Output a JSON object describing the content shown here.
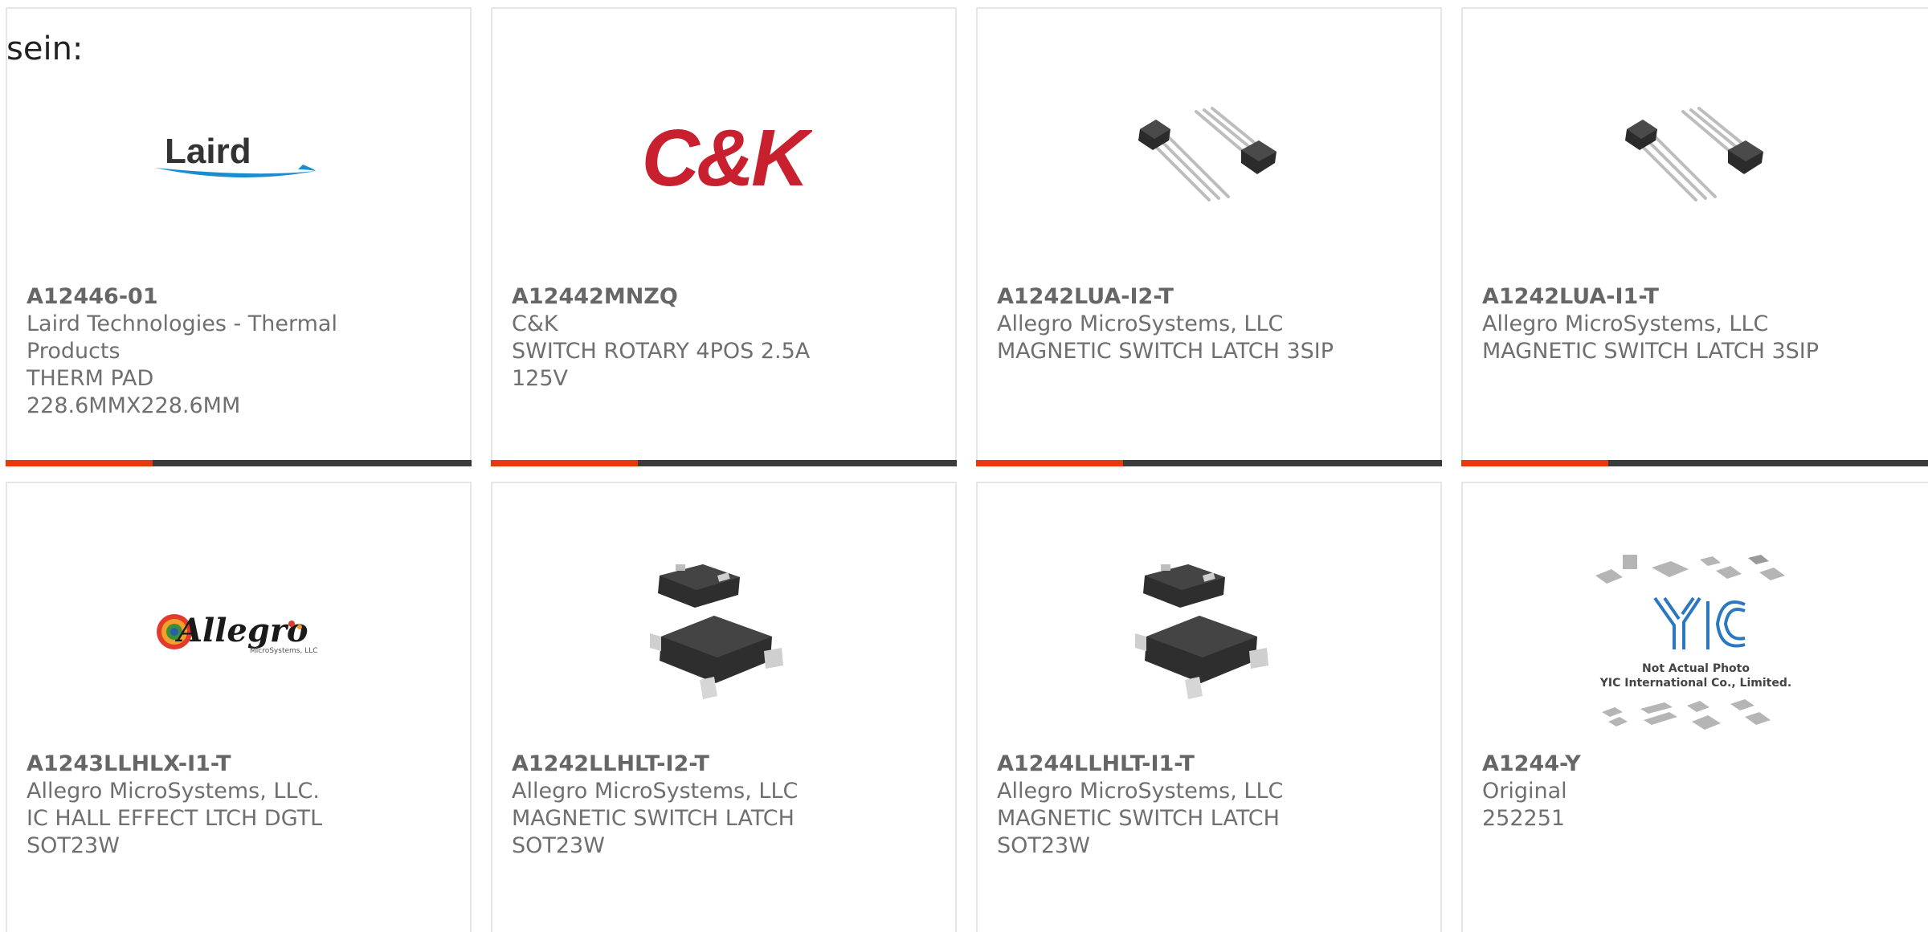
{
  "page": {
    "caption": "sein:"
  },
  "products": [
    {
      "part_number": "A12446-01",
      "manufacturer": "Laird Technologies - Thermal Products",
      "description": "THERM PAD 228.6MMX228.6MM",
      "image": "laird-logo",
      "logo_text": "Laird"
    },
    {
      "part_number": "A12442MNZQ",
      "manufacturer": "C&K",
      "description": "SWITCH ROTARY 4POS 2.5A 125V",
      "image": "ck-logo",
      "logo_text": "C&K"
    },
    {
      "part_number": "A1242LUA-I2-T",
      "manufacturer": "Allegro MicroSystems, LLC",
      "description": "MAGNETIC SWITCH LATCH 3SIP",
      "image": "to92-component-photo"
    },
    {
      "part_number": "A1242LUA-I1-T",
      "manufacturer": "Allegro MicroSystems, LLC",
      "description": "MAGNETIC SWITCH LATCH 3SIP",
      "image": "to92-component-photo"
    },
    {
      "part_number": "A1243LLHLX-I1-T",
      "manufacturer": "Allegro MicroSystems, LLC.",
      "description": "IC HALL EFFECT LTCH DGTL SOT23W",
      "image": "allegro-logo",
      "logo_text": "Allegro",
      "logo_subtext": "MicroSystems, LLC"
    },
    {
      "part_number": "A1242LLHLT-I2-T",
      "manufacturer": "Allegro MicroSystems, LLC",
      "description": "MAGNETIC SWITCH LATCH SOT23W",
      "image": "sot23-component-photo"
    },
    {
      "part_number": "A1244LLHLT-I1-T",
      "manufacturer": "Allegro MicroSystems, LLC",
      "description": "MAGNETIC SWITCH LATCH SOT23W",
      "image": "sot23-component-photo"
    },
    {
      "part_number": "A1244-Y",
      "manufacturer": "Original",
      "description": "252251",
      "image": "yic-placeholder-photo",
      "logo_text": "YIC",
      "placeholder_line1": "Not Actual Photo",
      "placeholder_line2": "YIC International Co., Limited."
    }
  ],
  "colors": {
    "accent": "#e8380d",
    "bar": "#3b3b3b",
    "card_border": "#e6e6e6",
    "text": "#6f6f6f"
  }
}
